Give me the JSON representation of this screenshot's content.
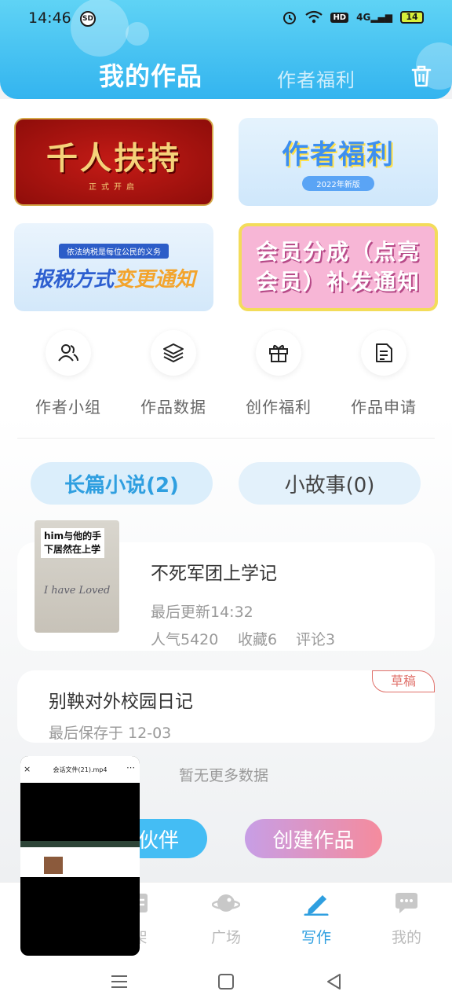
{
  "status_bar": {
    "time": "14:46",
    "badge": "SD",
    "net": "4G",
    "hd": "HD",
    "battery": "14"
  },
  "header": {
    "active_tab": "我的作品",
    "other_tab": "作者福利"
  },
  "banners": [
    {
      "title": "千人扶持",
      "subtitle": "正式开启"
    },
    {
      "title": "作者福利",
      "subtitle": "2022年新版"
    },
    {
      "tag": "依法纳税是每位公民的义务",
      "title_a": "报税方式",
      "title_b": "变更通知"
    },
    {
      "title": "会员分成（点亮会员）补发通知"
    }
  ],
  "quick_actions": [
    {
      "label": "作者小组",
      "icon": "users-icon"
    },
    {
      "label": "作品数据",
      "icon": "layers-icon"
    },
    {
      "label": "创作福利",
      "icon": "gift-icon"
    },
    {
      "label": "作品申请",
      "icon": "document-icon"
    }
  ],
  "category_tabs": {
    "novel": "长篇小说(2)",
    "story": "小故事(0)"
  },
  "works": [
    {
      "cover_caption_1": "him与他的手",
      "cover_caption_2": "下居然在上学",
      "cover_scribble": "I have Loved",
      "title": "不死军团上学记",
      "updated": "最后更新14:32",
      "popularity": "人气5420",
      "favorites": "收藏6",
      "comments": "评论3"
    },
    {
      "title": "别鞅对外校园日记",
      "saved": "最后保存于 12-03",
      "badge": "草稿"
    }
  ],
  "no_more": "暂无更多数据",
  "buttons": {
    "partner": "伙伴",
    "create": "创建作品"
  },
  "bottom_tabs": [
    {
      "label": "架",
      "icon": "bookshelf-icon"
    },
    {
      "label": "广场",
      "icon": "planet-icon"
    },
    {
      "label": "写作",
      "icon": "pen-icon"
    },
    {
      "label": "我的",
      "icon": "chat-icon"
    }
  ],
  "pip": {
    "file_name": "会话文件(21).mp4"
  },
  "colors": {
    "accent": "#2f9fe0",
    "header_top": "#5fd3f5",
    "header_bottom": "#33b4ef",
    "draft": "#e0706a"
  }
}
